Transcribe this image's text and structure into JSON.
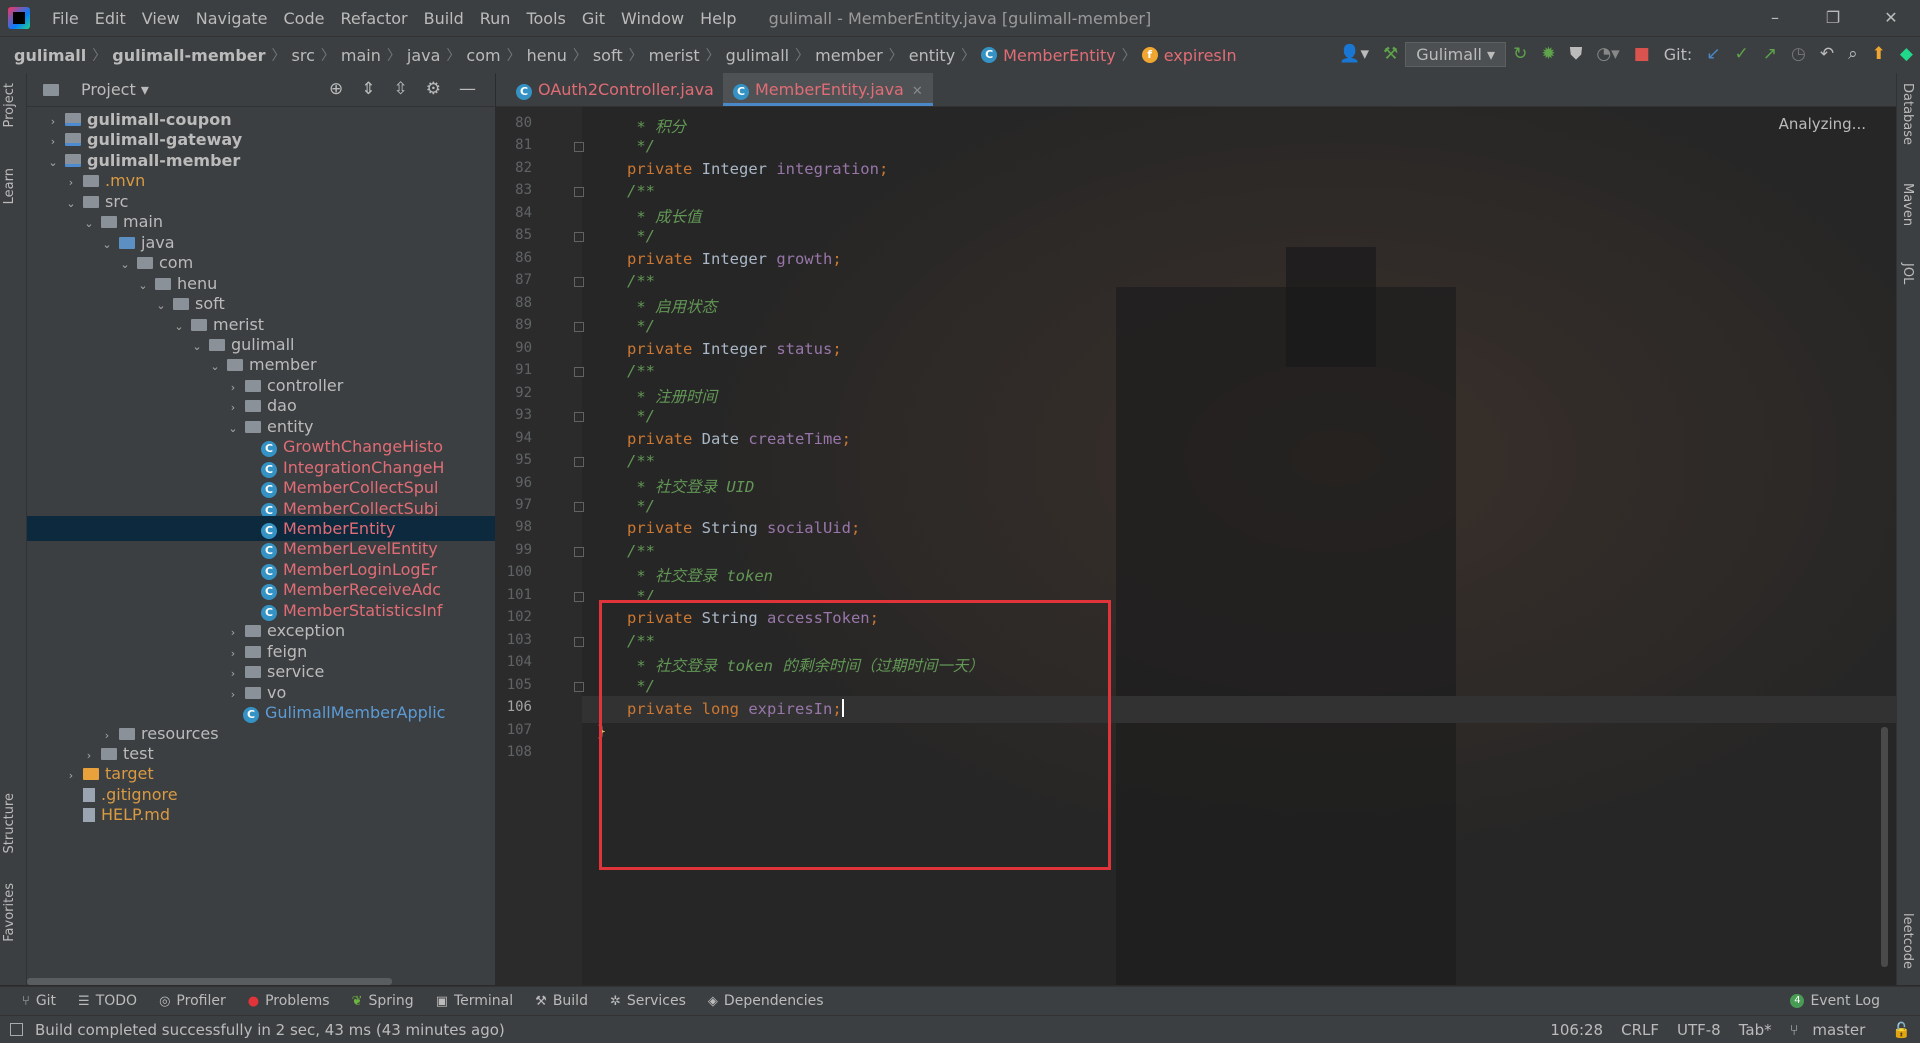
{
  "menu": {
    "items": [
      "File",
      "Edit",
      "View",
      "Navigate",
      "Code",
      "Refactor",
      "Build",
      "Run",
      "Tools",
      "Git",
      "Window",
      "Help"
    ],
    "window_title": "gulimall - MemberEntity.java [gulimall-member]"
  },
  "breadcrumb": {
    "items": [
      "gulimall",
      "gulimall-member",
      "src",
      "main",
      "java",
      "com",
      "henu",
      "soft",
      "merist",
      "gulimall",
      "member",
      "entity"
    ],
    "class_name": "MemberEntity",
    "field_name": "expiresIn"
  },
  "toolbar": {
    "run_config": "Gulimall",
    "git_label": "Git:"
  },
  "project_panel": {
    "title": "Project",
    "tree": [
      {
        "label": "gulimall-coupon",
        "depth": 0,
        "expanded": false,
        "kind": "module",
        "bold": true
      },
      {
        "label": "gulimall-gateway",
        "depth": 0,
        "expanded": false,
        "kind": "module",
        "bold": true
      },
      {
        "label": "gulimall-member",
        "depth": 0,
        "expanded": true,
        "kind": "module",
        "bold": true
      },
      {
        "label": ".mvn",
        "depth": 1,
        "expanded": false,
        "kind": "folder",
        "color": "orange"
      },
      {
        "label": "src",
        "depth": 1,
        "expanded": true,
        "kind": "folder"
      },
      {
        "label": "main",
        "depth": 2,
        "expanded": true,
        "kind": "folder"
      },
      {
        "label": "java",
        "depth": 3,
        "expanded": true,
        "kind": "folder-blue"
      },
      {
        "label": "com",
        "depth": 4,
        "expanded": true,
        "kind": "folder"
      },
      {
        "label": "henu",
        "depth": 5,
        "expanded": true,
        "kind": "folder"
      },
      {
        "label": "soft",
        "depth": 6,
        "expanded": true,
        "kind": "folder"
      },
      {
        "label": "merist",
        "depth": 7,
        "expanded": true,
        "kind": "folder"
      },
      {
        "label": "gulimall",
        "depth": 8,
        "expanded": true,
        "kind": "folder"
      },
      {
        "label": "member",
        "depth": 9,
        "expanded": true,
        "kind": "folder"
      },
      {
        "label": "controller",
        "depth": 10,
        "expanded": false,
        "kind": "folder"
      },
      {
        "label": "dao",
        "depth": 10,
        "expanded": false,
        "kind": "folder"
      },
      {
        "label": "entity",
        "depth": 10,
        "expanded": true,
        "kind": "folder"
      },
      {
        "label": "GrowthChangeHisto",
        "depth": 11,
        "kind": "class"
      },
      {
        "label": "IntegrationChangeH",
        "depth": 11,
        "kind": "class"
      },
      {
        "label": "MemberCollectSpul",
        "depth": 11,
        "kind": "class"
      },
      {
        "label": "MemberCollectSubj",
        "depth": 11,
        "kind": "class"
      },
      {
        "label": "MemberEntity",
        "depth": 11,
        "kind": "class",
        "selected": true
      },
      {
        "label": "MemberLevelEntity",
        "depth": 11,
        "kind": "class"
      },
      {
        "label": "MemberLoginLogEr",
        "depth": 11,
        "kind": "class"
      },
      {
        "label": "MemberReceiveAdc",
        "depth": 11,
        "kind": "class"
      },
      {
        "label": "MemberStatisticsInf",
        "depth": 11,
        "kind": "class"
      },
      {
        "label": "exception",
        "depth": 10,
        "expanded": false,
        "kind": "folder"
      },
      {
        "label": "feign",
        "depth": 10,
        "expanded": false,
        "kind": "folder"
      },
      {
        "label": "service",
        "depth": 10,
        "expanded": false,
        "kind": "folder"
      },
      {
        "label": "vo",
        "depth": 10,
        "expanded": false,
        "kind": "folder"
      },
      {
        "label": "GulimallMemberApplic",
        "depth": 10,
        "kind": "app-class"
      },
      {
        "label": "resources",
        "depth": 3,
        "expanded": false,
        "kind": "folder"
      },
      {
        "label": "test",
        "depth": 2,
        "expanded": false,
        "kind": "folder"
      },
      {
        "label": "target",
        "depth": 1,
        "expanded": false,
        "kind": "folder-orange",
        "color": "orange"
      },
      {
        "label": ".gitignore",
        "depth": 1,
        "kind": "file",
        "color": "orange"
      },
      {
        "label": "HELP.md",
        "depth": 1,
        "kind": "file",
        "color": "orange"
      }
    ]
  },
  "tabs": [
    {
      "label": "OAuth2Controller.java",
      "active": false
    },
    {
      "label": "MemberEntity.java",
      "active": true
    }
  ],
  "editor": {
    "status": "Analyzing...",
    "current_line": 106,
    "lines": [
      {
        "n": 80,
        "tokens": [
          {
            "t": " * 积分",
            "c": "cm"
          }
        ]
      },
      {
        "n": 81,
        "tokens": [
          {
            "t": " */",
            "c": "cm"
          }
        ]
      },
      {
        "n": 82,
        "tokens": [
          {
            "t": "private ",
            "c": "kw"
          },
          {
            "t": "Integer ",
            "c": "ty"
          },
          {
            "t": "integration",
            "c": "fd"
          },
          {
            "t": ";",
            "c": "kw"
          }
        ]
      },
      {
        "n": 83,
        "tokens": [
          {
            "t": "/**",
            "c": "cm"
          }
        ]
      },
      {
        "n": 84,
        "tokens": [
          {
            "t": " * 成长值",
            "c": "cm"
          }
        ]
      },
      {
        "n": 85,
        "tokens": [
          {
            "t": " */",
            "c": "cm"
          }
        ]
      },
      {
        "n": 86,
        "tokens": [
          {
            "t": "private ",
            "c": "kw"
          },
          {
            "t": "Integer ",
            "c": "ty"
          },
          {
            "t": "growth",
            "c": "fd"
          },
          {
            "t": ";",
            "c": "kw"
          }
        ]
      },
      {
        "n": 87,
        "tokens": [
          {
            "t": "/**",
            "c": "cm"
          }
        ]
      },
      {
        "n": 88,
        "tokens": [
          {
            "t": " * 启用状态",
            "c": "cm"
          }
        ]
      },
      {
        "n": 89,
        "tokens": [
          {
            "t": " */",
            "c": "cm"
          }
        ]
      },
      {
        "n": 90,
        "tokens": [
          {
            "t": "private ",
            "c": "kw"
          },
          {
            "t": "Integer ",
            "c": "ty"
          },
          {
            "t": "status",
            "c": "fd"
          },
          {
            "t": ";",
            "c": "kw"
          }
        ]
      },
      {
        "n": 91,
        "tokens": [
          {
            "t": "/**",
            "c": "cm"
          }
        ]
      },
      {
        "n": 92,
        "tokens": [
          {
            "t": " * 注册时间",
            "c": "cm"
          }
        ]
      },
      {
        "n": 93,
        "tokens": [
          {
            "t": " */",
            "c": "cm"
          }
        ]
      },
      {
        "n": 94,
        "tokens": [
          {
            "t": "private ",
            "c": "kw"
          },
          {
            "t": "Date ",
            "c": "ty"
          },
          {
            "t": "createTime",
            "c": "fd"
          },
          {
            "t": ";",
            "c": "kw"
          }
        ]
      },
      {
        "n": 95,
        "tokens": [
          {
            "t": "/**",
            "c": "cm"
          }
        ]
      },
      {
        "n": 96,
        "tokens": [
          {
            "t": " * 社交登录 UID",
            "c": "cm"
          }
        ]
      },
      {
        "n": 97,
        "tokens": [
          {
            "t": " */",
            "c": "cm"
          }
        ]
      },
      {
        "n": 98,
        "tokens": [
          {
            "t": "private ",
            "c": "kw"
          },
          {
            "t": "String ",
            "c": "ty"
          },
          {
            "t": "socialUid",
            "c": "fd"
          },
          {
            "t": ";",
            "c": "kw"
          }
        ]
      },
      {
        "n": 99,
        "tokens": [
          {
            "t": "/**",
            "c": "cm"
          }
        ]
      },
      {
        "n": 100,
        "tokens": [
          {
            "t": " * 社交登录 token",
            "c": "cm"
          }
        ]
      },
      {
        "n": 101,
        "tokens": [
          {
            "t": " */",
            "c": "cm"
          }
        ]
      },
      {
        "n": 102,
        "tokens": [
          {
            "t": "private ",
            "c": "kw"
          },
          {
            "t": "String ",
            "c": "ty"
          },
          {
            "t": "accessToken",
            "c": "fd"
          },
          {
            "t": ";",
            "c": "kw"
          }
        ]
      },
      {
        "n": 103,
        "tokens": [
          {
            "t": "/**",
            "c": "cm"
          }
        ]
      },
      {
        "n": 104,
        "tokens": [
          {
            "t": " * 社交登录 token 的剩余时间（过期时间一天）",
            "c": "cm"
          }
        ]
      },
      {
        "n": 105,
        "tokens": [
          {
            "t": " */",
            "c": "cm"
          }
        ]
      },
      {
        "n": 106,
        "tokens": [
          {
            "t": "private ",
            "c": "kw"
          },
          {
            "t": "long ",
            "c": "kw"
          },
          {
            "t": "expiresIn",
            "c": "fd"
          },
          {
            "t": ";",
            "c": "kw"
          }
        ],
        "caret": true
      },
      {
        "n": 107,
        "tokens": [
          {
            "t": "}",
            "c": "br"
          }
        ],
        "outdent": true
      },
      {
        "n": 108,
        "tokens": []
      }
    ]
  },
  "left_stripe": [
    "Project",
    "Learn",
    "Structure",
    "Favorites"
  ],
  "right_stripe": [
    "Database",
    "Maven",
    "JOL",
    "leetcode"
  ],
  "bottom_tools": [
    "Git",
    "TODO",
    "Profiler",
    "Problems",
    "Spring",
    "Terminal",
    "Build",
    "Services",
    "Dependencies"
  ],
  "event_log": {
    "label": "Event Log",
    "count": "4"
  },
  "status": {
    "message": "Build completed successfully in 2 sec, 43 ms (43 minutes ago)",
    "position": "106:28",
    "line_sep": "CRLF",
    "encoding": "UTF-8",
    "indent": "Tab*",
    "branch": "master"
  },
  "colors": {
    "accent_red": "#e0343a",
    "keyword": "#cc7832",
    "field": "#9876aa",
    "comment": "#629755",
    "class_name": "#e06c75"
  }
}
